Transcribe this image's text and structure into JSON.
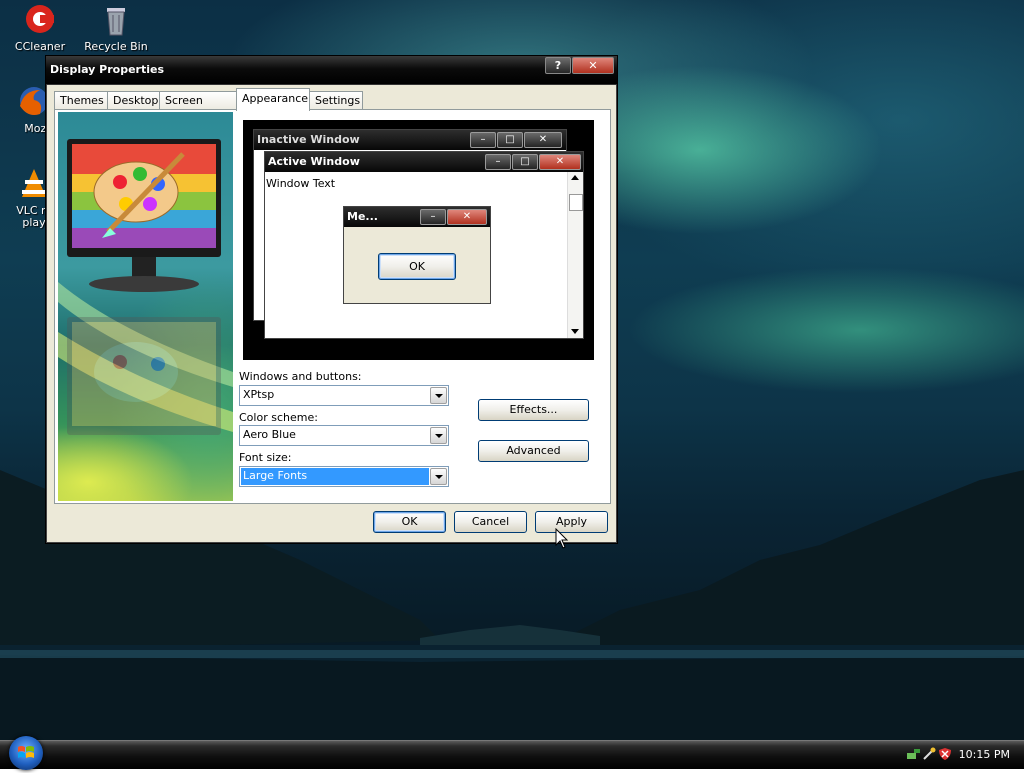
{
  "desktop": {
    "icons": [
      {
        "label": "CCleaner"
      },
      {
        "label": "Recycle Bin"
      },
      {
        "label": "Mozilla F"
      },
      {
        "label": "VLC m"
      },
      {
        "label": "play"
      }
    ]
  },
  "dialog": {
    "title": "Display Properties",
    "tabs": [
      "Themes",
      "Desktop",
      "Screen Saver",
      "Appearance",
      "Settings"
    ],
    "active_tab": "Appearance",
    "preview": {
      "inactive_title": "Inactive Window",
      "active_title": "Active Window",
      "window_text": "Window Text",
      "message_title": "Me...",
      "message_ok": "OK"
    },
    "windows_buttons_label": "Windows and buttons:",
    "windows_buttons_value": "XPtsp",
    "color_scheme_label": "Color scheme:",
    "color_scheme_value": "Aero Blue",
    "font_size_label": "Font size:",
    "font_size_value": "Large Fonts",
    "effects_button": "Effects...",
    "advanced_button": "Advanced",
    "ok_button": "OK",
    "cancel_button": "Cancel",
    "apply_button": "Apply"
  },
  "taskbar": {
    "clock": "10:15 PM"
  }
}
